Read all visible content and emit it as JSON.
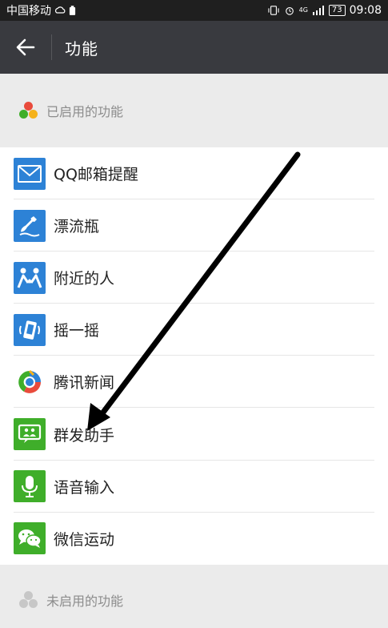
{
  "status_bar": {
    "carrier": "中国移动",
    "network": "4G",
    "battery": "73",
    "time": "09:08"
  },
  "header": {
    "title": "功能",
    "back_icon": "arrow-left-icon"
  },
  "sections": {
    "enabled_title": "已启用的功能",
    "disabled_title": "未启用的功能"
  },
  "features": [
    {
      "label": "QQ邮箱提醒",
      "icon": "mail-icon",
      "color": "#2d82d6"
    },
    {
      "label": "漂流瓶",
      "icon": "drift-bottle-icon",
      "color": "#2d82d6"
    },
    {
      "label": "附近的人",
      "icon": "people-nearby-icon",
      "color": "#2d82d6"
    },
    {
      "label": "摇一摇",
      "icon": "shake-icon",
      "color": "#2d82d6"
    },
    {
      "label": "腾讯新闻",
      "icon": "tencent-news-icon",
      "color": "#ffffff"
    },
    {
      "label": "群发助手",
      "icon": "mass-message-icon",
      "color": "#3fae2a"
    },
    {
      "label": "语音输入",
      "icon": "microphone-icon",
      "color": "#3fae2a"
    },
    {
      "label": "微信运动",
      "icon": "wechat-sport-icon",
      "color": "#3fae2a"
    }
  ],
  "colors": {
    "title_bar": "#393a3f",
    "status_bar": "#1f1f1f",
    "background": "#ebebeb",
    "blue": "#2d82d6",
    "green": "#3fae2a"
  }
}
